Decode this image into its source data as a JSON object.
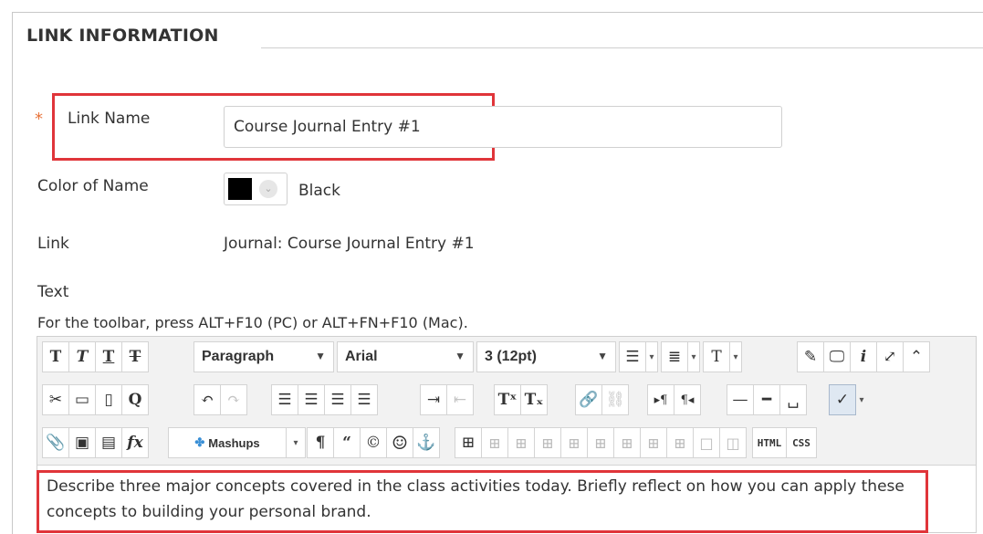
{
  "section": {
    "title": "LINK INFORMATION"
  },
  "form": {
    "required_mark": "*",
    "link_name_label": "Link Name",
    "link_name_value": "Course Journal Entry #1",
    "color_label": "Color of Name",
    "color_value": "Black",
    "color_swatch": "#000000",
    "link_label": "Link",
    "link_value": "Journal: Course Journal Entry #1",
    "text_label": "Text",
    "toolbar_hint": "For the toolbar, press ALT+F10 (PC) or ALT+FN+F10 (Mac)."
  },
  "toolbar": {
    "format_select": "Paragraph",
    "font_select": "Arial",
    "size_select": "3 (12pt)",
    "mashups_label": "Mashups",
    "html_label": "HTML",
    "css_label": "CSS",
    "icons": {
      "bold": "T",
      "italic": "T",
      "underline": "T",
      "strike": "T",
      "cut": "✂",
      "copy": "🗋",
      "paste": "📋",
      "find": "Q",
      "pilcrow": "¶",
      "quote": "“",
      "copyright": "©",
      "smiley": "☺",
      "anchor": "⚓",
      "info": "i",
      "fx": "fx"
    }
  },
  "editor": {
    "content": "Describe three major concepts covered in the class activities today. Briefly reflect on how you can apply these concepts to building your personal brand."
  },
  "colors": {
    "highlight": "#e0353a",
    "required": "#e8743b"
  }
}
